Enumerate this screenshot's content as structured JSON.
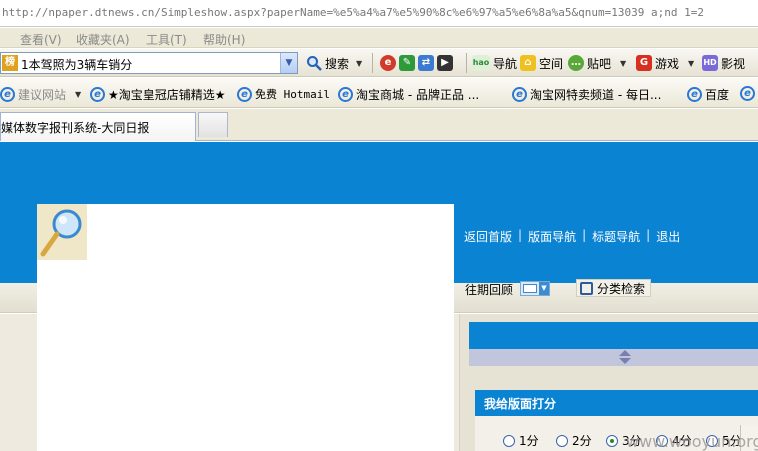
{
  "address_bar": {
    "url": "http://npaper.dtnews.cn/Simpleshow.aspx?paperName=%e5%a4%a7%e5%90%8c%e6%97%a5%e6%8a%a5&qnum=13039 a;nd 1=2"
  },
  "menu": {
    "items": [
      "查看(V)",
      "收藏夹(A)",
      "工具(T)",
      "帮助(H)"
    ]
  },
  "toolbar": {
    "search_box_badge": "榜",
    "search_box_value": "1本驾照为3辆车销分",
    "search_label": "搜索",
    "nav_label": "导航",
    "space_label": "空间",
    "tieba_label": "贴吧",
    "games_label": "游戏",
    "video_label": "影视",
    "hao_badge": "hao"
  },
  "favorites": {
    "items": [
      "建议网站",
      "★淘宝皇冠店铺精选★",
      "免费 Hotmail",
      "淘宝商城 - 品牌正品 ...",
      "淘宝网特卖频道 - 每日...",
      "百度"
    ]
  },
  "tabs": {
    "active_title": "媒体数字报刊系统-大同日报"
  },
  "page": {
    "nav_links": [
      "返回首版",
      "版面导航",
      "标题导航",
      "退出"
    ],
    "past_issues_label": "往期回顾",
    "category_search_label": "分类检索",
    "rating_title": "我给版面打分",
    "rating_options": [
      "1分",
      "2分",
      "3分",
      "4分",
      "5分"
    ],
    "selected_rating": "3分",
    "watermark": "www.wooyun.org"
  },
  "colors": {
    "banner_blue": "#0a83d3",
    "lavender": "#c2c6dc"
  }
}
